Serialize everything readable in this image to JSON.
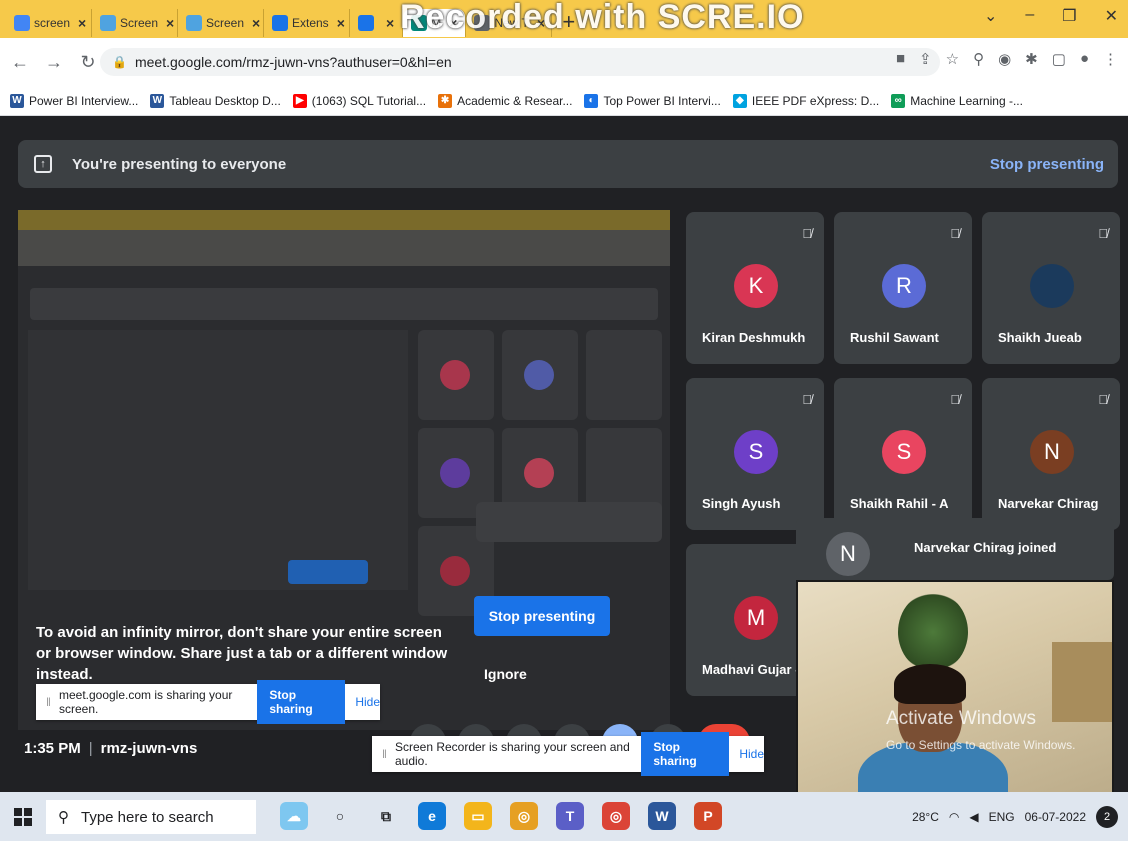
{
  "browser": {
    "tabs": [
      {
        "label": "screen",
        "color": "#4285f4",
        "active": false
      },
      {
        "label": "Screen",
        "color": "#4fa3e0",
        "active": false
      },
      {
        "label": "Screen",
        "color": "#4fa3e0",
        "active": false
      },
      {
        "label": "Extens",
        "color": "#1a73e8",
        "active": false
      },
      {
        "label": "",
        "color": "#1a73e8",
        "active": false
      },
      {
        "label": "M",
        "color": "#00897b",
        "active": true
      },
      {
        "label": "New T",
        "color": "#5f6368",
        "active": false
      }
    ],
    "new_tab": "+",
    "watermark": "Recorded with SCRE.IO",
    "url": "meet.google.com/rmz-juwn-vns?authuser=0&hl=en",
    "bookmarks": [
      {
        "label": "Power BI Interview...",
        "icon": "W",
        "color": "#2b579a"
      },
      {
        "label": "Tableau Desktop D...",
        "icon": "W",
        "color": "#2b579a"
      },
      {
        "label": "(1063) SQL Tutorial...",
        "icon": "▶",
        "color": "#ff0000"
      },
      {
        "label": "Academic & Resear...",
        "icon": "✱",
        "color": "#e8710a"
      },
      {
        "label": "Top Power BI Intervi...",
        "icon": "◐",
        "color": "#1a73e8"
      },
      {
        "label": "IEEE PDF eXpress: D...",
        "icon": "◆",
        "color": "#00a3e0"
      },
      {
        "label": "Machine Learning -...",
        "icon": "∞",
        "color": "#0f9d58"
      }
    ]
  },
  "meet": {
    "presenting_text": "You're presenting to everyone",
    "stop_presenting_link": "Stop presenting",
    "mirror_warning": "To avoid an infinity mirror, don't share your entire screen or browser window. Share just a tab or a different window instead.",
    "center_stop": "Stop presenting",
    "center_ignore": "Ignore",
    "participants": [
      {
        "initial": "K",
        "name": "Kiran Deshmukh",
        "color": "#d93654"
      },
      {
        "initial": "R",
        "name": "Rushil Sawant",
        "color": "#5b6bd6"
      },
      {
        "initial": "",
        "name": "Shaikh Jueab",
        "color": "#1b3a5c"
      },
      {
        "initial": "S",
        "name": "Singh Ayush",
        "color": "#6e3fc8"
      },
      {
        "initial": "S",
        "name": "Shaikh Rahil - A",
        "color": "#e94560"
      },
      {
        "initial": "N",
        "name": "Narvekar Chirag",
        "color": "#7a3e22"
      },
      {
        "initial": "M",
        "name": "Madhavi Gujar -",
        "color": "#c3263e"
      }
    ],
    "joined": {
      "initial": "N",
      "text": "Narvekar Chirag joined"
    },
    "time": "1:35 PM",
    "meeting_code": "rmz-juwn-vns",
    "activate_title": "Activate Windows",
    "activate_sub": "Go to Settings to activate Windows."
  },
  "share_bars": {
    "meet": {
      "text": "meet.google.com is sharing your screen.",
      "stop": "Stop sharing",
      "hide": "Hide"
    },
    "recorder": {
      "text": "Screen Recorder is sharing your screen and audio.",
      "stop": "Stop sharing",
      "hide": "Hide"
    }
  },
  "taskbar": {
    "search_placeholder": "Type here to search",
    "temp": "28°C",
    "lang": "ENG",
    "date": "06-07-2022",
    "notifications": "2"
  }
}
